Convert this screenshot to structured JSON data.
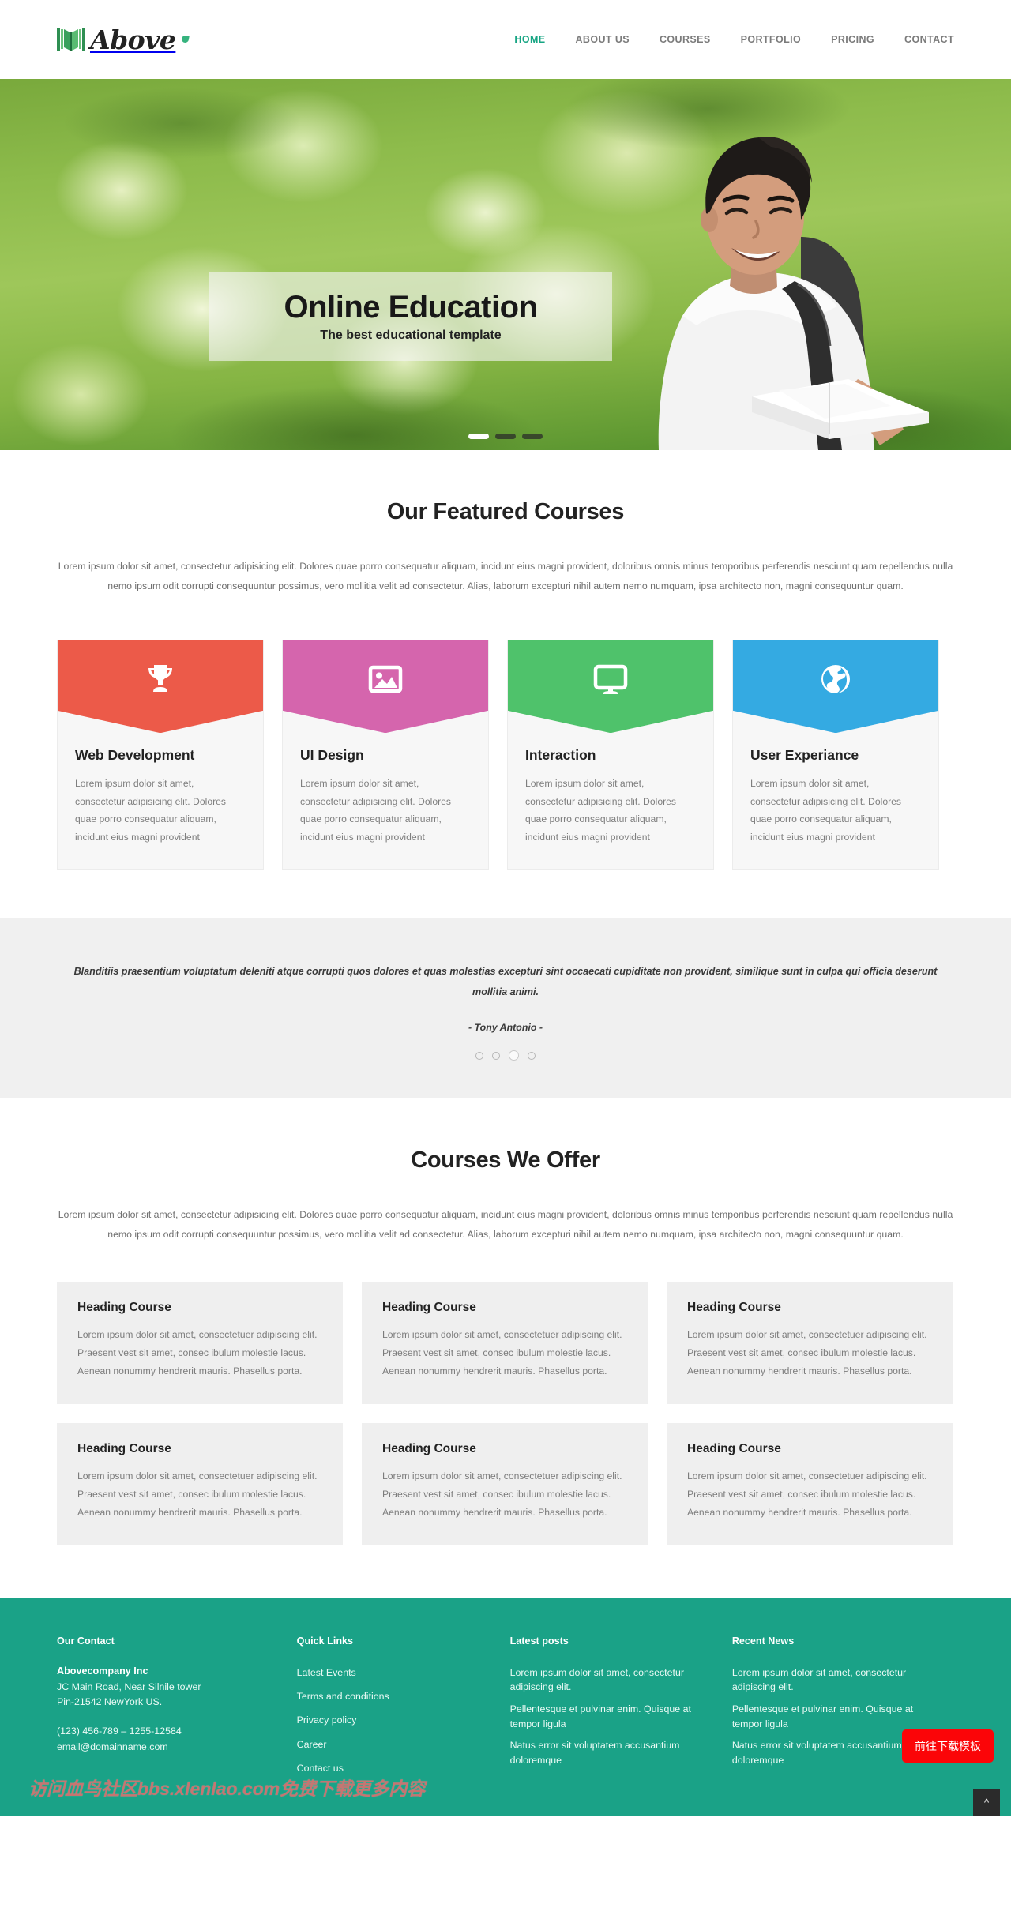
{
  "header": {
    "logo_text": "Above",
    "logo_icon": "open-book-icon",
    "nav": [
      {
        "label": "HOME",
        "active": true
      },
      {
        "label": "ABOUT US",
        "active": false
      },
      {
        "label": "COURSES",
        "active": false
      },
      {
        "label": "PORTFOLIO",
        "active": false
      },
      {
        "label": "PRICING",
        "active": false
      },
      {
        "label": "CONTACT",
        "active": false
      }
    ]
  },
  "hero": {
    "title": "Online Education",
    "subtitle": "The best educational template",
    "slides": 3,
    "active_slide": 1
  },
  "featured": {
    "title": "Our Featured Courses",
    "lead": "Lorem ipsum dolor sit amet, consectetur adipisicing elit. Dolores quae porro consequatur aliquam, incidunt eius magni provident, doloribus omnis minus temporibus perferendis nesciunt quam repellendus nulla nemo ipsum odit corrupti consequuntur possimus, vero mollitia velit ad consectetur. Alias, laborum excepturi nihil autem nemo numquam, ipsa architecto non, magni consequuntur quam.",
    "cards": [
      {
        "name": "Web Development",
        "icon": "trophy-icon",
        "color": "#ec5a49",
        "desc": "Lorem ipsum dolor sit amet, consectetur adipisicing elit. Dolores quae porro consequatur aliquam, incidunt eius magni provident"
      },
      {
        "name": "UI Design",
        "icon": "image-icon",
        "color": "#d565ad",
        "desc": "Lorem ipsum dolor sit amet, consectetur adipisicing elit. Dolores quae porro consequatur aliquam, incidunt eius magni provident"
      },
      {
        "name": "Interaction",
        "icon": "monitor-icon",
        "color": "#4fc26b",
        "desc": "Lorem ipsum dolor sit amet, consectetur adipisicing elit. Dolores quae porro consequatur aliquam, incidunt eius magni provident"
      },
      {
        "name": "User Experiance",
        "icon": "globe-icon",
        "color": "#34aae2",
        "desc": "Lorem ipsum dolor sit amet, consectetur adipisicing elit. Dolores quae porro consequatur aliquam, incidunt eius magni provident"
      }
    ]
  },
  "testimonial": {
    "quote": "Blanditiis praesentium voluptatum deleniti atque corrupti quos dolores et quas molestias excepturi sint occaecati cupiditate non provident, similique sunt in culpa qui officia deserunt mollitia animi.",
    "author": "- Tony Antonio -",
    "dots": 4,
    "active_dot": 2
  },
  "offer": {
    "title": "Courses We Offer",
    "lead": "Lorem ipsum dolor sit amet, consectetur adipisicing elit. Dolores quae porro consequatur aliquam, incidunt eius magni provident, doloribus omnis minus temporibus perferendis nesciunt quam repellendus nulla nemo ipsum odit corrupti consequuntur possimus, vero mollitia velit ad consectetur. Alias, laborum excepturi nihil autem nemo numquam, ipsa architecto non, magni consequuntur quam.",
    "cards": [
      {
        "title": "Heading Course",
        "desc": "Lorem ipsum dolor sit amet, consectetuer adipiscing elit. Praesent vest sit amet, consec ibulum molestie lacus. Aenean nonummy hendrerit mauris. Phasellus porta."
      },
      {
        "title": "Heading Course",
        "desc": "Lorem ipsum dolor sit amet, consectetuer adipiscing elit. Praesent vest sit amet, consec ibulum molestie lacus. Aenean nonummy hendrerit mauris. Phasellus porta."
      },
      {
        "title": "Heading Course",
        "desc": "Lorem ipsum dolor sit amet, consectetuer adipiscing elit. Praesent vest sit amet, consec ibulum molestie lacus. Aenean nonummy hendrerit mauris. Phasellus porta."
      },
      {
        "title": "Heading Course",
        "desc": "Lorem ipsum dolor sit amet, consectetuer adipiscing elit. Praesent vest sit amet, consec ibulum molestie lacus. Aenean nonummy hendrerit mauris. Phasellus porta."
      },
      {
        "title": "Heading Course",
        "desc": "Lorem ipsum dolor sit amet, consectetuer adipiscing elit. Praesent vest sit amet, consec ibulum molestie lacus. Aenean nonummy hendrerit mauris. Phasellus porta."
      },
      {
        "title": "Heading Course",
        "desc": "Lorem ipsum dolor sit amet, consectetuer adipiscing elit. Praesent vest sit amet, consec ibulum molestie lacus. Aenean nonummy hendrerit mauris. Phasellus porta."
      }
    ]
  },
  "footer": {
    "bg_color": "#1aa287",
    "contact": {
      "heading": "Our Contact",
      "company": "Abovecompany Inc",
      "address_line1": "JC Main Road, Near Silnile tower",
      "address_line2": "Pin-21542 NewYork US.",
      "phone": "(123) 456-789 – 1255-12584",
      "email": "email@domainname.com"
    },
    "quick_links": {
      "heading": "Quick Links",
      "items": [
        "Latest Events",
        "Terms and conditions",
        "Privacy policy",
        "Career",
        "Contact us"
      ]
    },
    "latest_posts": {
      "heading": "Latest posts",
      "items": [
        "Lorem ipsum dolor sit amet, consectetur adipiscing elit.",
        "Pellentesque et pulvinar enim. Quisque at tempor ligula",
        "Natus error sit voluptatem accusantium doloremque"
      ]
    },
    "recent_news": {
      "heading": "Recent News",
      "items": [
        "Lorem ipsum dolor sit amet, consectetur adipiscing elit.",
        "Pellentesque et pulvinar enim. Quisque at tempor ligula",
        "Natus error sit voluptatem accusantium doloremque"
      ]
    }
  },
  "overlays": {
    "watermark": "访问血鸟社区bbs.xlenlao.com免费下载更多内容",
    "download_button": "前往下载模板",
    "to_top_icon": "chevron-up-icon",
    "to_top_label": "^"
  }
}
